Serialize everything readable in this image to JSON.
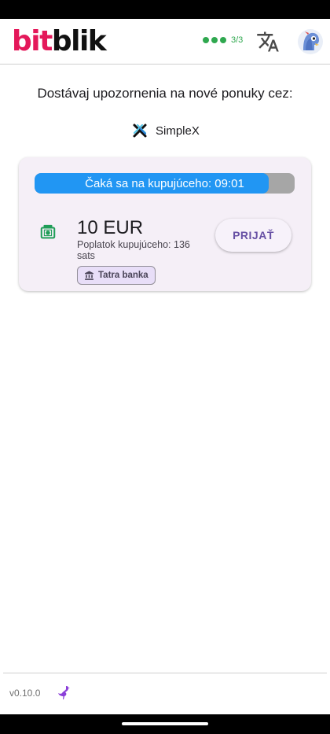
{
  "app": {
    "logo_bit": "bit",
    "logo_blik": "blik",
    "peers": "3/3",
    "peers_color": "#2fa84f",
    "language_icon": "translate-icon",
    "avatar_icon": "robot-avatar-icon"
  },
  "main": {
    "notify_text": "Dostávaj upozornenia na nové ponuky cez:",
    "notify_service": "SimpleX"
  },
  "offer": {
    "status": "Čaká sa na kupujúceho: 09:01",
    "progress_fraction": 0.9,
    "progress_color": "#2196f3",
    "amount": "10 EUR",
    "fee": "Poplatok kupujúceho: 136 sats",
    "bank": "Tatra banka",
    "accept_label": "PRIJAŤ",
    "payment_icon": "cash-icon",
    "bank_icon": "bank-icon"
  },
  "footer": {
    "version": "v0.10.0",
    "icon": "ostrich-icon"
  }
}
